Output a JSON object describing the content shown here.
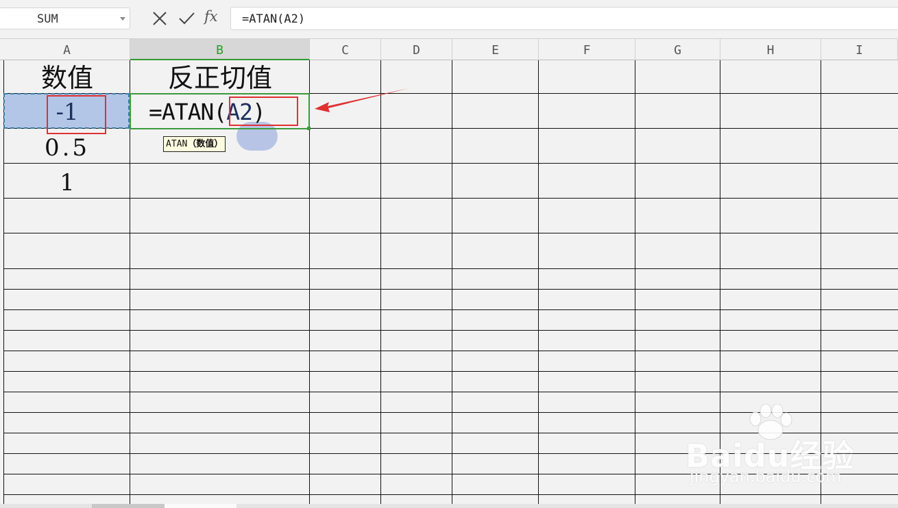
{
  "formula_bar": {
    "name_box": "SUM",
    "fx_label": "fx",
    "formula": "=ATAN(A2)"
  },
  "columns": [
    "A",
    "B",
    "C",
    "D",
    "E",
    "F",
    "G",
    "H",
    "I"
  ],
  "active_column": "B",
  "cells": {
    "A1": "数值",
    "B1": "反正切值",
    "A2": "-1",
    "A3": "0.5",
    "A4": "1",
    "B2_prefix": "=ATAN(",
    "B2_ref": "A2",
    "B2_suffix": ")"
  },
  "tooltip": {
    "function": "ATAN",
    "argument": "（数值）"
  },
  "colors": {
    "selection_green": "#3a9a3a",
    "reference_fill": "#b4c6e7",
    "annotation_red": "#e03030"
  },
  "watermark": {
    "logo": "Baidu经验",
    "url": "jingyan.baidu.com"
  }
}
